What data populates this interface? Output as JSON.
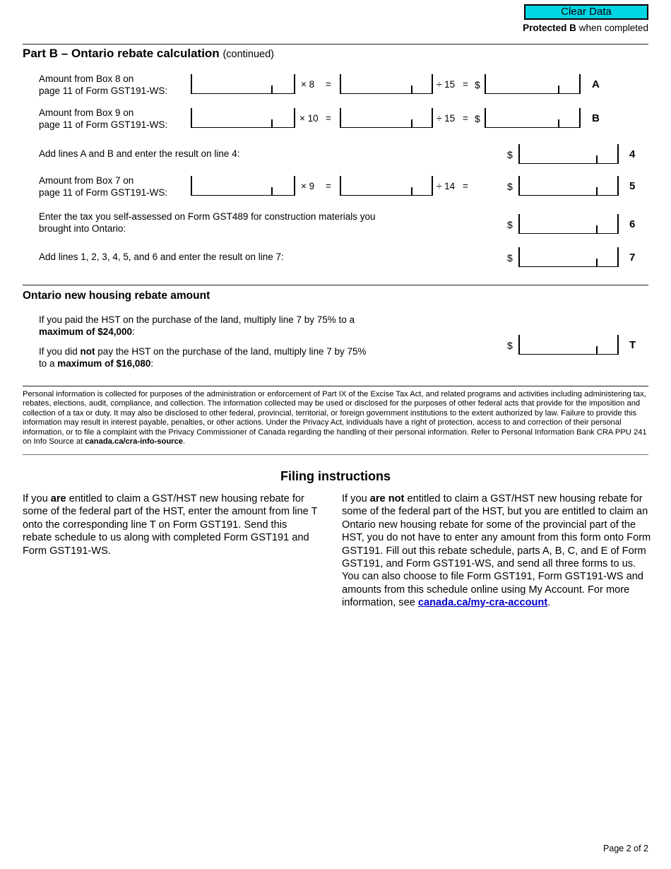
{
  "header": {
    "clear_data_label": "Clear Data",
    "protected_bold": "Protected B",
    "protected_rest": " when completed"
  },
  "part_b": {
    "title": "Part B – Ontario rebate calculation",
    "title_continued": "(continued)",
    "rows": [
      {
        "label_line1": "Amount from Box 8 on",
        "label_line2": "page 11 of Form GST191-WS:",
        "multiply_op": "× 8",
        "equals_1": "=",
        "divide_op": "÷ 15",
        "equals_2": "=",
        "currency": "$",
        "line_label": "A"
      },
      {
        "label_line1": "Amount from Box 9 on",
        "label_line2": "page 11 of Form GST191-WS:",
        "multiply_op": "× 10",
        "equals_1": "=",
        "divide_op": "÷ 15",
        "equals_2": "=",
        "currency": "$",
        "line_label": "B"
      }
    ],
    "line4": {
      "label": "Add lines A and B and enter the result on line 4:",
      "currency": "$",
      "line_label": "4"
    },
    "line5": {
      "label_line1": "Amount from Box 7 on",
      "label_line2": "page 11 of Form GST191-WS:",
      "multiply_op": "× 9",
      "equals_1": "=",
      "divide_op": "÷ 14",
      "equals_2": "=",
      "currency": "$",
      "line_label": "5"
    },
    "line6": {
      "label_line1": "Enter the tax you self-assessed on Form GST489 for construction materials you",
      "label_line2": "brought into Ontario:",
      "currency": "$",
      "line_label": "6"
    },
    "line7": {
      "label": "Add lines 1, 2, 3, 4, 5, and 6 and enter the result on line 7:",
      "currency": "$",
      "line_label": "7"
    }
  },
  "rebate_amount": {
    "title": "Ontario new housing rebate amount",
    "para1_part1": "If you paid the HST on the purchase of the land, multiply line 7 by 75% to a",
    "para1_bold": "maximum of $24,000",
    "para1_end": ":",
    "para2_part1": "If you did ",
    "para2_bold1": "not",
    "para2_part2": " pay the HST on the purchase of the land, multiply line 7 by 75%",
    "para2_line2_part1": "to a ",
    "para2_bold2": "maximum of $16,080",
    "para2_end": ":",
    "currency": "$",
    "line_label": "T"
  },
  "privacy": {
    "text_before_link": "Personal information is collected for purposes of the administration or enforcement of Part IX of the Excise Tax Act, and related programs and activities including administering tax, rebates, elections, audit, compliance, and collection. The information collected may be used or disclosed for the purposes of other federal acts that provide for the imposition and collection of a tax or duty. It may also be disclosed to other federal, provincial, territorial, or foreign government institutions to the extent authorized by law. Failure to provide this information may result in interest payable, penalties, or other actions. Under the Privacy Act, individuals have a right of protection, access to and correction of their personal information, or to file a complaint with the Privacy Commissioner of Canada regarding the handling of their personal information. Refer to Personal Information Bank CRA PPU 241 on Info Source at ",
    "link_text": "canada.ca/cra-info-source",
    "text_after_link": "."
  },
  "filing": {
    "title": "Filing instructions",
    "left_part1": "If you ",
    "left_bold": "are",
    "left_part2": " entitled to claim a GST/HST new housing rebate for some of the federal part of the HST, enter the amount from line T onto the corresponding line T on Form GST191. Send this rebate schedule to us along with completed Form GST191 and Form GST191-WS.",
    "right_part1": "If you ",
    "right_bold": "are not",
    "right_part2": " entitled to claim a GST/HST new housing rebate for some of the federal part of the HST, but you are entitled to claim an Ontario new housing rebate for some of the provincial part of the HST, you do not have to enter any amount from this form onto Form GST191. Fill out this rebate schedule, parts A, B, C, and E of Form GST191, and Form GST191-WS, and send all three forms to us. You can also choose to file Form GST191, Form GST191-WS and amounts from this schedule online using My Account. For more information, see ",
    "right_link": "canada.ca/my-cra-account",
    "right_end": "."
  },
  "footer": {
    "page_label": "Page 2 of 2"
  },
  "fields": {
    "a_amount": "",
    "a_product": "",
    "a_result": "",
    "b_amount": "",
    "b_product": "",
    "b_result": "",
    "line4": "",
    "line5_amount": "",
    "line5_product": "",
    "line5_result": "",
    "line6": "",
    "line7": "",
    "line_t": ""
  },
  "colors": {
    "clear_data_bg": "#00d5e3",
    "link": "#0000cd",
    "rule": "#6f6f6f"
  }
}
